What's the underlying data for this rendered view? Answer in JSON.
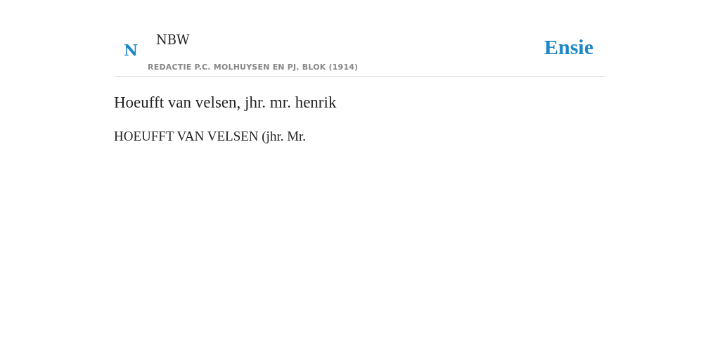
{
  "header": {
    "letter": "N",
    "source": "NBW",
    "subtitle": "REDACTIE P.C. MOLHUYSEN EN PJ. BLOK (1914)",
    "logo": "Ensie"
  },
  "article": {
    "title": "Hoeufft van velsen, jhr. mr. henrik",
    "text": "HOEUFFT VAN VELSEN (jhr. Mr."
  }
}
